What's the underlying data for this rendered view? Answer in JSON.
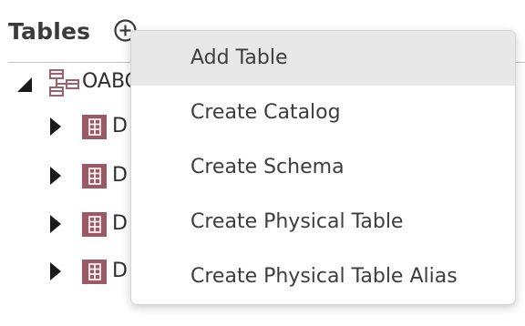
{
  "panel": {
    "title": "Tables",
    "add_icon": "plus-circle-icon"
  },
  "tree": {
    "root": {
      "label": "OABC",
      "expanded": true,
      "icon": "database-icon"
    },
    "children": [
      {
        "label": "D",
        "icon": "table-icon",
        "expanded": false
      },
      {
        "label": "D",
        "icon": "table-icon",
        "expanded": false
      },
      {
        "label": "D",
        "icon": "table-icon",
        "expanded": false
      },
      {
        "label": "D",
        "icon": "table-icon",
        "expanded": false
      }
    ]
  },
  "menu": {
    "items": [
      {
        "label": "Add Table",
        "highlighted": true
      },
      {
        "label": "Create Catalog",
        "highlighted": false
      },
      {
        "label": "Create Schema",
        "highlighted": false
      },
      {
        "label": "Create Physical Table",
        "highlighted": false
      },
      {
        "label": "Create Physical Table Alias",
        "highlighted": false
      }
    ]
  },
  "colors": {
    "table_icon": "#9c5a66",
    "database_icon": "#a0606c",
    "menu_highlight": "#e8e8e8"
  }
}
